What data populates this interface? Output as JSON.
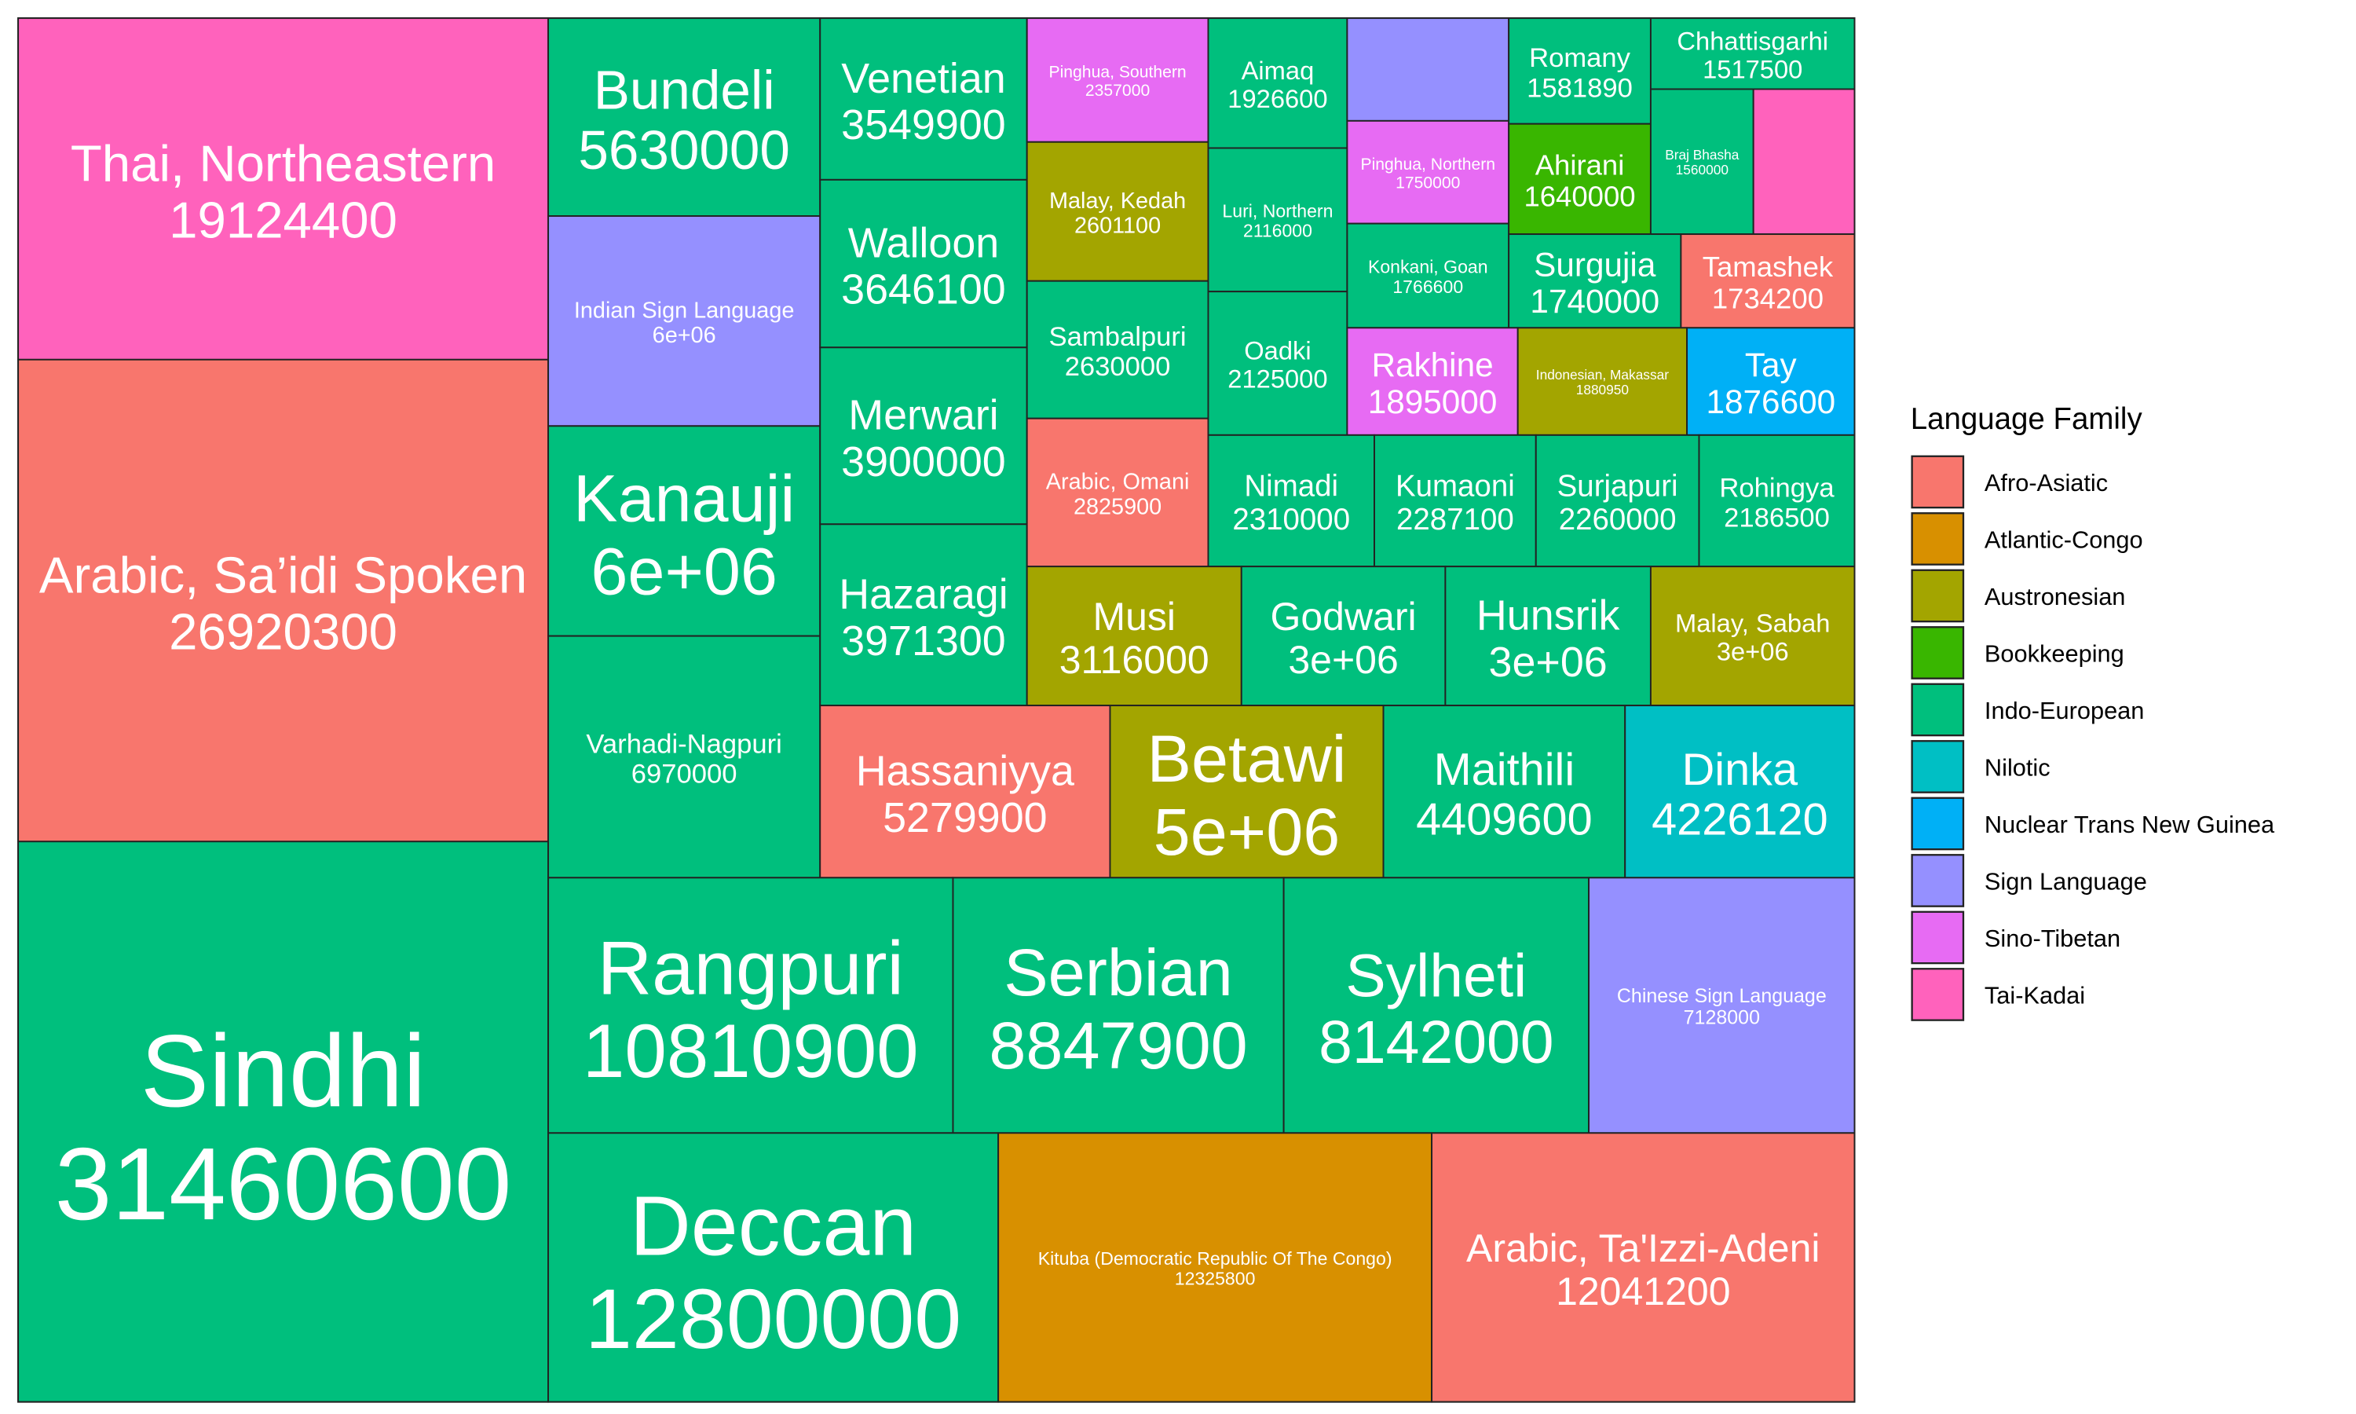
{
  "chart_data": {
    "type": "treemap",
    "legend": {
      "title": "Language Family",
      "position": "right"
    },
    "families": [
      {
        "name": "Afro-Asiatic",
        "color": "#F8766D"
      },
      {
        "name": "Atlantic-Congo",
        "color": "#D89000"
      },
      {
        "name": "Austronesian",
        "color": "#A3A500"
      },
      {
        "name": "Bookkeeping",
        "color": "#39B600"
      },
      {
        "name": "Indo-European",
        "color": "#00BF7D"
      },
      {
        "name": "Nilotic",
        "color": "#00BFC4"
      },
      {
        "name": "Nuclear Trans New Guinea",
        "color": "#00B0F6"
      },
      {
        "name": "Sign Language",
        "color": "#9590FF"
      },
      {
        "name": "Sino-Tibetan",
        "color": "#E76BF3"
      },
      {
        "name": "Tai-Kadai",
        "color": "#FF62BC"
      }
    ],
    "tiles": [
      {
        "name": "Sindhi",
        "value": "31460600",
        "family": "Indo-European"
      },
      {
        "name": "Arabic, Sa’idi Spoken",
        "value": "26920300",
        "family": "Afro-Asiatic"
      },
      {
        "name": "Thai, Northeastern",
        "value": "19124400",
        "family": "Tai-Kadai"
      },
      {
        "name": "Bundeli",
        "value": "5630000",
        "family": "Indo-European"
      },
      {
        "name": "Indian Sign Language",
        "value": "6e+06",
        "family": "Sign Language"
      },
      {
        "name": "Kanauji",
        "value": "6e+06",
        "family": "Indo-European"
      },
      {
        "name": "Varhadi-Nagpuri",
        "value": "6970000",
        "family": "Indo-European"
      },
      {
        "name": "Venetian",
        "value": "3549900",
        "family": "Indo-European"
      },
      {
        "name": "Walloon",
        "value": "3646100",
        "family": "Indo-European"
      },
      {
        "name": "Merwari",
        "value": "3900000",
        "family": "Indo-European"
      },
      {
        "name": "Hazaragi",
        "value": "3971300",
        "family": "Indo-European"
      },
      {
        "name": "Pinghua, Southern",
        "value": "2357000",
        "family": "Sino-Tibetan"
      },
      {
        "name": "Malay, Kedah",
        "value": "2601100",
        "family": "Austronesian"
      },
      {
        "name": "Sambalpuri",
        "value": "2630000",
        "family": "Indo-European"
      },
      {
        "name": "Arabic, Omani",
        "value": "2825900",
        "family": "Afro-Asiatic"
      },
      {
        "name": "Aimaq",
        "value": "1926600",
        "family": "Indo-European"
      },
      {
        "name": "Luri, Northern",
        "value": "2116000",
        "family": "Indo-European"
      },
      {
        "name": "Oadki",
        "value": "2125000",
        "family": "Indo-European"
      },
      {
        "name": "",
        "value": "",
        "family": "Sign Language"
      },
      {
        "name": "Pinghua, Northern",
        "value": "1750000",
        "family": "Sino-Tibetan"
      },
      {
        "name": "Konkani, Goan",
        "value": "1766600",
        "family": "Indo-European"
      },
      {
        "name": "Romany",
        "value": "1581890",
        "family": "Indo-European"
      },
      {
        "name": "Ahirani",
        "value": "1640000",
        "family": "Bookkeeping"
      },
      {
        "name": "Chhattisgarhi",
        "value": "1517500",
        "family": "Indo-European"
      },
      {
        "name": "Braj Bhasha",
        "value": "1560000",
        "family": "Indo-European"
      },
      {
        "name": "",
        "value": "",
        "family": "Tai-Kadai"
      },
      {
        "name": "Surgujia",
        "value": "1740000",
        "family": "Indo-European"
      },
      {
        "name": "Tamashek",
        "value": "1734200",
        "family": "Afro-Asiatic"
      },
      {
        "name": "Rakhine",
        "value": "1895000",
        "family": "Sino-Tibetan"
      },
      {
        "name": "Indonesian, Makassar",
        "value": "1880950",
        "family": "Austronesian"
      },
      {
        "name": "Tay",
        "value": "1876600",
        "family": "Nuclear Trans New Guinea"
      },
      {
        "name": "Nimadi",
        "value": "2310000",
        "family": "Indo-European"
      },
      {
        "name": "Kumaoni",
        "value": "2287100",
        "family": "Indo-European"
      },
      {
        "name": "Surjapuri",
        "value": "2260000",
        "family": "Indo-European"
      },
      {
        "name": "Rohingya",
        "value": "2186500",
        "family": "Indo-European"
      },
      {
        "name": "Musi",
        "value": "3116000",
        "family": "Austronesian"
      },
      {
        "name": "Godwari",
        "value": "3e+06",
        "family": "Indo-European"
      },
      {
        "name": "Hunsrik",
        "value": "3e+06",
        "family": "Indo-European"
      },
      {
        "name": "Malay, Sabah",
        "value": "3e+06",
        "family": "Austronesian"
      },
      {
        "name": "Hassaniyya",
        "value": "5279900",
        "family": "Afro-Asiatic"
      },
      {
        "name": "Betawi",
        "value": "5e+06",
        "family": "Austronesian"
      },
      {
        "name": "Maithili",
        "value": "4409600",
        "family": "Indo-European"
      },
      {
        "name": "Dinka",
        "value": "4226120",
        "family": "Nilotic"
      },
      {
        "name": "Rangpuri",
        "value": "10810900",
        "family": "Indo-European"
      },
      {
        "name": "Serbian",
        "value": "8847900",
        "family": "Indo-European"
      },
      {
        "name": "Sylheti",
        "value": "8142000",
        "family": "Indo-European"
      },
      {
        "name": "Chinese Sign Language",
        "value": "7128000",
        "family": "Sign Language"
      },
      {
        "name": "Deccan",
        "value": "12800000",
        "family": "Indo-European"
      },
      {
        "name": "Kituba (Democratic Republic Of The Congo)",
        "value": "12325800",
        "family": "Atlantic-Congo"
      },
      {
        "name": "Arabic, Ta'Izzi-Adeni",
        "value": "12041200",
        "family": "Afro-Asiatic"
      }
    ]
  }
}
